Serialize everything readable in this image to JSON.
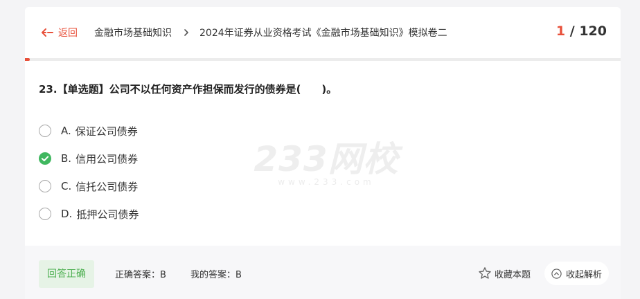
{
  "header": {
    "back_label": "返回",
    "breadcrumb": {
      "subject": "金融市场基础知识",
      "paper": "2024年证券从业资格考试《金融市场基础知识》模拟卷二"
    },
    "counter": {
      "current": "1",
      "separator": " / ",
      "total": "120"
    },
    "progress": 0.008333,
    "accent_color": "#e8503a"
  },
  "question": {
    "text": "23.【单选题】公司不以任何资产作担保而发行的债券是(　　)。",
    "options": [
      {
        "letter": "A.",
        "text": "保证公司债券",
        "state": "unselected"
      },
      {
        "letter": "B.",
        "text": "信用公司债券",
        "state": "correct-selected"
      },
      {
        "letter": "C.",
        "text": "信托公司债券",
        "state": "unselected"
      },
      {
        "letter": "D.",
        "text": "抵押公司债券",
        "state": "unselected"
      }
    ],
    "correct_color": "#3fb75f"
  },
  "watermark": {
    "main": "233网校",
    "url": "www.233.com"
  },
  "footer": {
    "result": "回答正确",
    "correct_answer": "正确答案：B",
    "my_answer": "我的答案：B",
    "favorite_label": "收藏本题",
    "collapse_label": "收起解析"
  },
  "icons": {
    "back": "arrow-left-icon",
    "separator": "chevron-right-icon",
    "correct": "check-circle-icon",
    "favorite": "star-outline-icon",
    "collapse": "chevron-up-circle-icon"
  }
}
